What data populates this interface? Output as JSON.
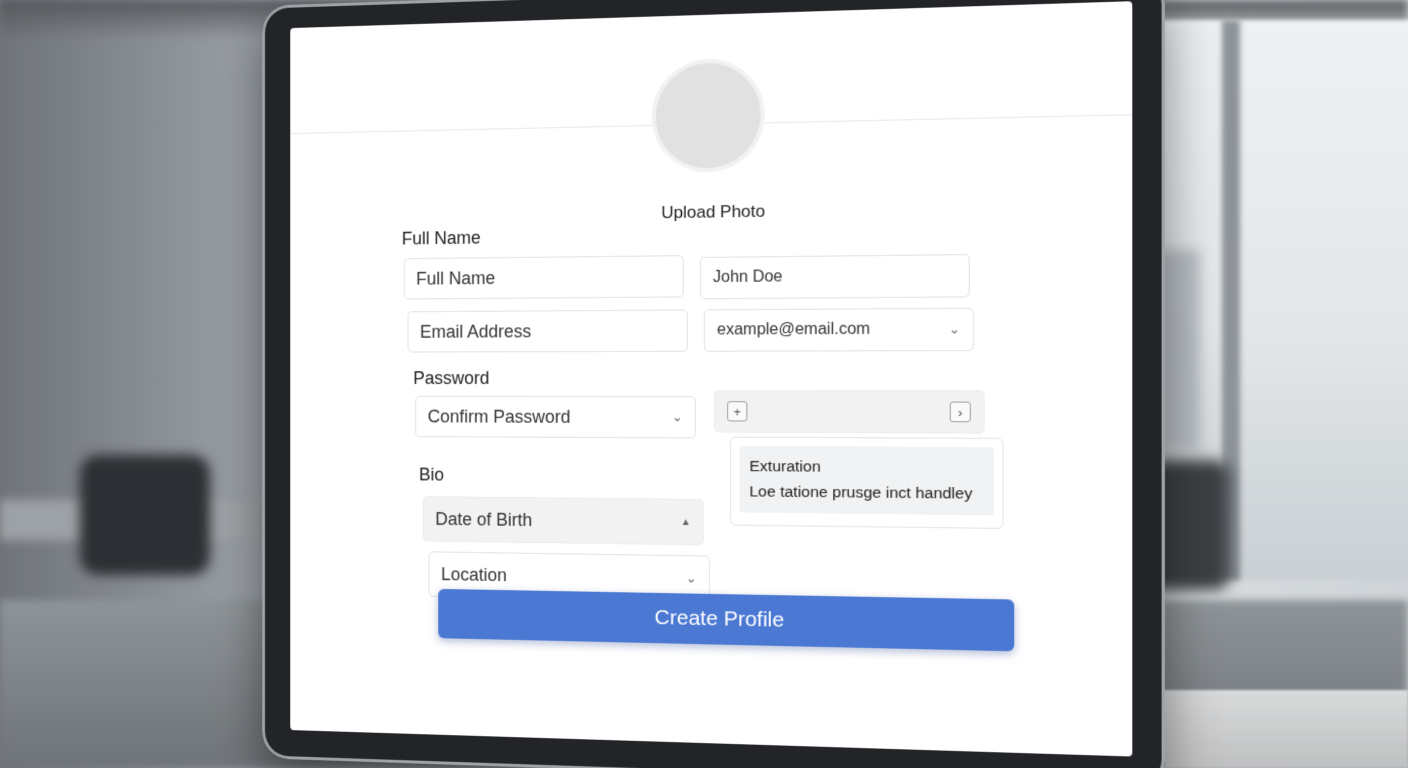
{
  "profile": {
    "upload_photo_label": "Upload Photo",
    "full_name_heading": "Full Name",
    "password_heading": "Password",
    "bio_heading": "Bio",
    "fields": {
      "full_name": "Full Name",
      "full_name_value": "John Doe",
      "email": "Email Address",
      "email_value": "example@email.com",
      "confirm_password": "Confirm Password",
      "date_of_birth": "Date of Birth",
      "location": "Location"
    },
    "bio_text_line1": "Exturation",
    "bio_text_line2": "Loe tatione prusge inct handley",
    "create_button": "Create Profile"
  },
  "icons": {
    "chevron_down": "chevron-down-icon",
    "chevron_up": "chevron-up-icon",
    "plus": "plus-icon",
    "chevron_right": "chevron-right-icon"
  },
  "colors": {
    "primary_button": "#4a78d3",
    "field_border": "#dfe1e4",
    "avatar_placeholder": "#e1e1e1"
  }
}
